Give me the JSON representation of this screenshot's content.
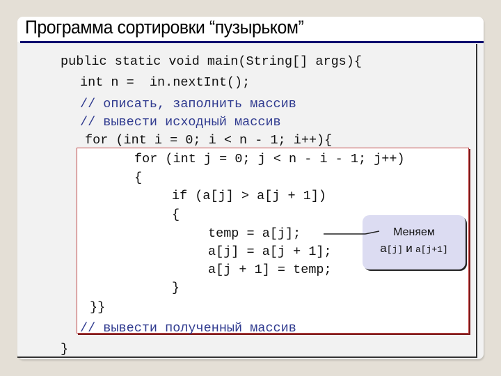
{
  "slide": {
    "title": "Программа сортировки “пузырьком”"
  },
  "code": {
    "lines": [
      "public static void main(String[] args){",
      "int n =  in.nextInt();",
      "// описать, заполнить массив",
      "// вывести исходный массив",
      "for (int i = 0; i < n - 1; i++){",
      "for (int j = 0; j < n - i - 1; j++)",
      "{",
      "if (a[j] > a[j + 1])",
      "{",
      "temp = a[j];",
      "a[j] = a[j + 1];",
      "a[j + 1] = temp;",
      "}",
      "}}",
      "// вывести полученный массив",
      "}"
    ]
  },
  "callout": {
    "line1": "Меняем",
    "a1": "a",
    "a1_index": "[j]",
    "conj": "и",
    "a2": "a[j+1]"
  },
  "colors": {
    "title_rule": "#0c0c6e",
    "comment": "#2f3a8f",
    "loop_box_border": "#c04848",
    "callout_bg": "#dcdcf2"
  }
}
